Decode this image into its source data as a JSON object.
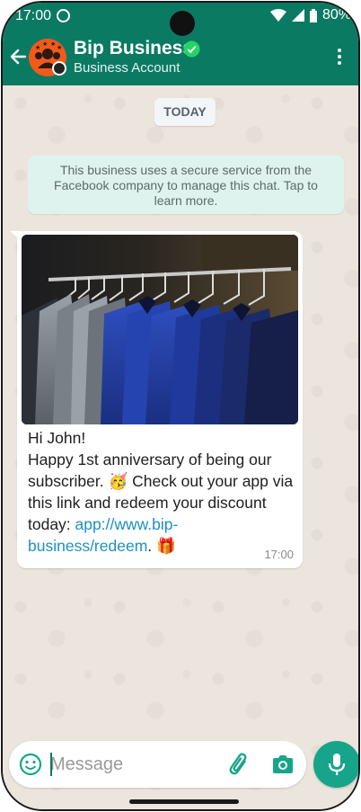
{
  "status_bar": {
    "time": "17:00",
    "battery_text": "80%"
  },
  "header": {
    "contact_name": "Bip Business",
    "contact_subtitle": "Business Account",
    "icons": [
      "back-arrow-icon",
      "verified-icon",
      "more-vert-icon"
    ]
  },
  "chat": {
    "date_chip": "TODAY",
    "system_note": "This business uses a secure service from the Facebook company to manage this chat. Tap to learn more.",
    "message": {
      "greeting": "Hi John!",
      "body_part1": "Happy 1st anniversary of being our subscriber. 🥳 Check out your app via this link and redeem your discount today: ",
      "link": "app://www.bip-business/redeem",
      "body_part2": ". 🎁",
      "time": "17:00",
      "image_description_icon": "clothing-rack-photo"
    }
  },
  "composer": {
    "placeholder": "Message",
    "value": ""
  },
  "colors": {
    "header": "#0b7a63",
    "accent": "#16a58a",
    "link": "#1e8fc4",
    "chat_bg": "#ece5dd"
  }
}
